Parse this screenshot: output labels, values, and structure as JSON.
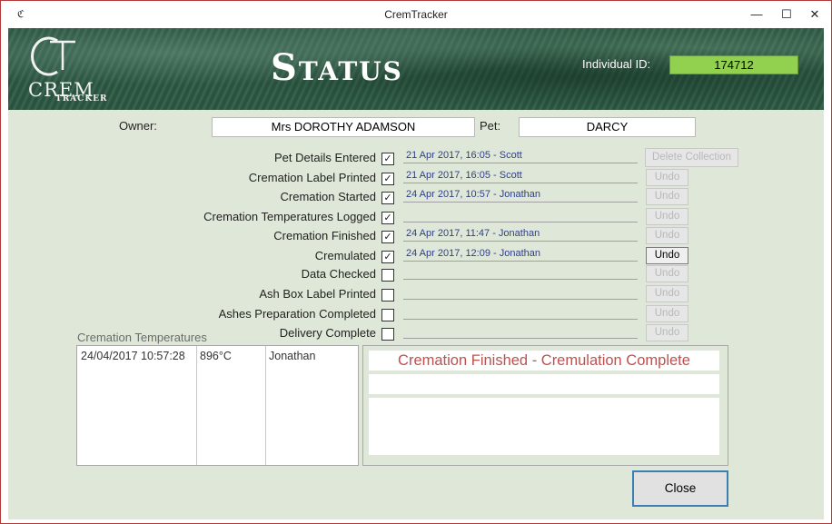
{
  "window": {
    "title": "CremTracker",
    "icon_text": "ℭ",
    "controls": {
      "minimize": "—",
      "maximize": "☐",
      "close": "✕"
    }
  },
  "header": {
    "logo_text_crem": "CREM",
    "logo_text_tracker": "TRACKER",
    "title": "Status",
    "individual_id_label": "Individual ID:",
    "individual_id_value": "174712"
  },
  "owner": {
    "label": "Owner:",
    "value": "Mrs DOROTHY ADAMSON"
  },
  "pet": {
    "label": "Pet:",
    "value": "DARCY"
  },
  "steps": [
    {
      "label": "Pet Details Entered",
      "checked": true,
      "stamp": "21 Apr 2017, 16:05 - Scott",
      "button": "Delete Collection",
      "button_enabled": false
    },
    {
      "label": "Cremation Label Printed",
      "checked": true,
      "stamp": "21 Apr 2017, 16:05 - Scott",
      "button": "Undo",
      "button_enabled": false
    },
    {
      "label": "Cremation Started",
      "checked": true,
      "stamp": "24 Apr 2017, 10:57 - Jonathan",
      "button": "Undo",
      "button_enabled": false
    },
    {
      "label": "Cremation Temperatures Logged",
      "checked": true,
      "stamp": "",
      "button": "Undo",
      "button_enabled": false
    },
    {
      "label": "Cremation Finished",
      "checked": true,
      "stamp": "24 Apr 2017, 11:47 - Jonathan",
      "button": "Undo",
      "button_enabled": false
    },
    {
      "label": "Cremulated",
      "checked": true,
      "stamp": "24 Apr 2017, 12:09 - Jonathan",
      "button": "Undo",
      "button_enabled": true
    },
    {
      "label": "Data Checked",
      "checked": false,
      "stamp": "",
      "button": "Undo",
      "button_enabled": false
    },
    {
      "label": "Ash Box Label Printed",
      "checked": false,
      "stamp": "",
      "button": "Undo",
      "button_enabled": false
    },
    {
      "label": "Ashes Preparation Completed",
      "checked": false,
      "stamp": "",
      "button": "Undo",
      "button_enabled": false
    },
    {
      "label": "Delivery Complete",
      "checked": false,
      "stamp": "",
      "button": "Undo",
      "button_enabled": false
    }
  ],
  "temperatures": {
    "label": "Cremation Temperatures",
    "rows": [
      {
        "datetime": "24/04/2017 10:57:28",
        "temp": "896°C",
        "user": "Jonathan"
      }
    ]
  },
  "message": {
    "line1": "Cremation Finished - Cremulation Complete",
    "line2": "",
    "line3": ""
  },
  "close_label": "Close",
  "colors": {
    "background": "#dfe8d8",
    "id_highlight": "#92d050",
    "status_message": "#c0504d",
    "stamp_text": "#2e3e8a"
  }
}
